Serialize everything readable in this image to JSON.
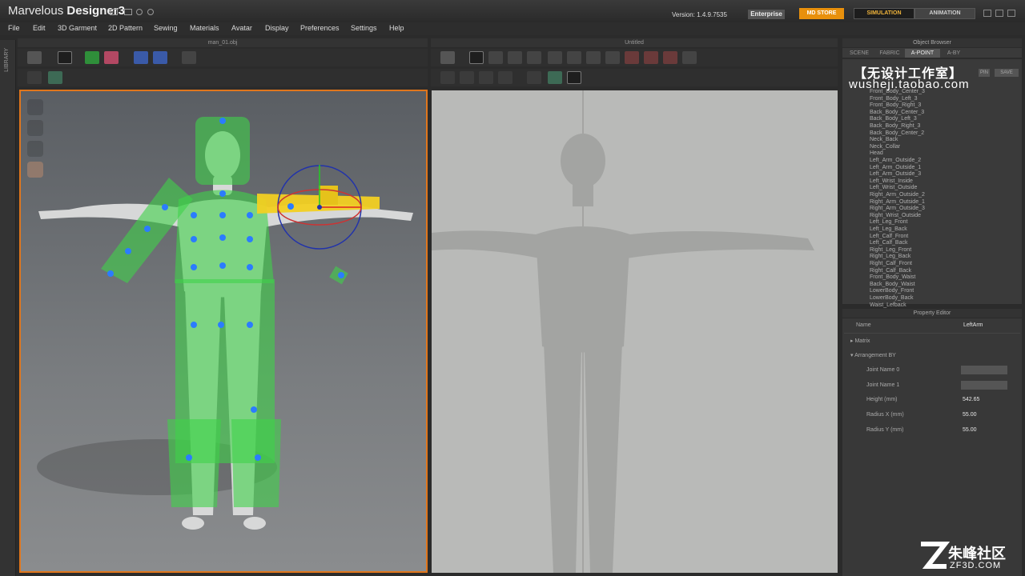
{
  "app": {
    "name_light": "Marvelous",
    "name_bold": "Designer",
    "name_num": "3",
    "version_label": "Version:",
    "version": "1.4.9.7535",
    "edition": "Enterprise",
    "store_button": "MD STORE",
    "mode_simulation": "SIMULATION",
    "mode_animation": "ANIMATION"
  },
  "menu": [
    "File",
    "Edit",
    "3D Garment",
    "2D Pattern",
    "Sewing",
    "Materials",
    "Avatar",
    "Display",
    "Preferences",
    "Settings",
    "Help"
  ],
  "library_label": "LIBRARY",
  "window3d": {
    "title": "man_01.obj"
  },
  "window2d": {
    "title": "Untitled"
  },
  "object_browser": {
    "title": "Object Browser",
    "tabs": [
      "SCENE",
      "FABRIC",
      "A-POINT",
      "A-BY"
    ],
    "active_tab": "A-POINT",
    "button_small": "PIN",
    "button_save": "SAVE",
    "items": [
      "Front_Body_Center_3",
      "Front_Body_Left_3",
      "Front_Body_Right_3",
      "Back_Body_Center_3",
      "Back_Body_Left_3",
      "Back_Body_Right_3",
      "Back_Body_Center_2",
      "Neck_Back",
      "Neck_Collar",
      "Head",
      "Left_Arm_Outside_2",
      "Left_Arm_Outside_1",
      "Left_Arm_Outside_3",
      "Left_Wrist_Inside",
      "Left_Wrist_Outside",
      "Right_Arm_Outside_2",
      "Right_Arm_Outside_1",
      "Right_Arm_Outside_3",
      "Right_Wrist_Outside",
      "Left_Leg_Front",
      "Left_Leg_Back",
      "Left_Calf_Front",
      "Left_Calf_Back",
      "Right_Leg_Front",
      "Right_Leg_Back",
      "Right_Calf_Front",
      "Right_Calf_Back",
      "Front_Body_Waist",
      "Back_Body_Waist",
      "LowerBody_Front",
      "LowerBody_Back",
      "Waist_Lefback"
    ]
  },
  "watermark": {
    "cn": "【无设计工作室】",
    "url": "wusheji.taobao.com"
  },
  "property_editor": {
    "title": "Property Editor",
    "name_label": "Name",
    "name_value": "LeftArm",
    "section_matrix": "Matrix",
    "section_arrangement": "Arrangement BY",
    "joint0_label": "Joint Name 0",
    "joint1_label": "Joint Name 1",
    "height_label": "Height (mm)",
    "height_value": "542.65",
    "radius_x_label": "Radius X (mm)",
    "radius_x_value": "55.00",
    "radius_y_label": "Radius Y (mm)",
    "radius_y_value": "55.00"
  },
  "site_logo": {
    "cn": "朱峰社区",
    "url": "ZF3D.COM"
  },
  "colors": {
    "accent_orange": "#e0761c",
    "arrangement_green": "#3fd24a",
    "selected_yellow": "#f2d022",
    "point_blue": "#2b7cff"
  }
}
